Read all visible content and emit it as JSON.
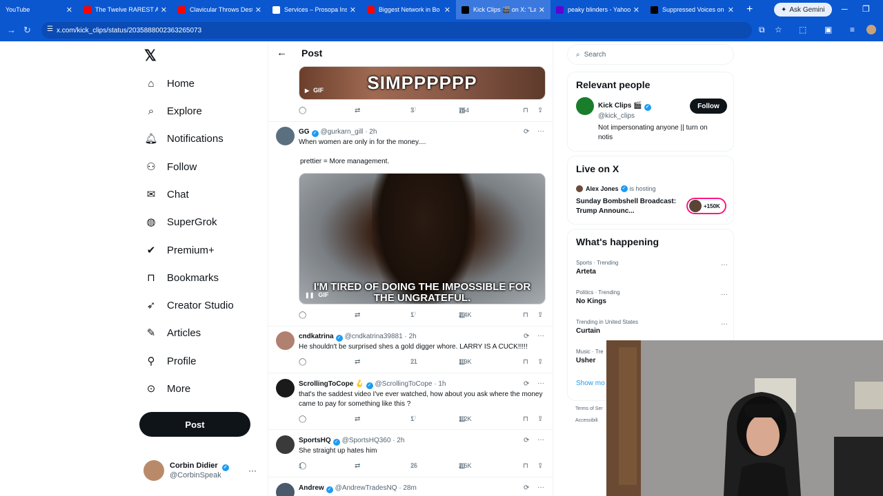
{
  "browser": {
    "tabs": [
      {
        "title": "YouTube",
        "color": "#ffffff"
      },
      {
        "title": "The Twelve RAREST An",
        "color": "#ff0000"
      },
      {
        "title": "Clavicular Throws Dest",
        "color": "#ff0000"
      },
      {
        "title": "Services – Prosopa Insi",
        "color": "#ffffff"
      },
      {
        "title": "Biggest Network in Bo",
        "color": "#ff0000"
      },
      {
        "title": "Kick Clips 🎬 on X: \"La",
        "color": "#000000"
      },
      {
        "title": "peaky blinders - Yahoo",
        "color": "#6001d2"
      },
      {
        "title": "Suppressed Voices on",
        "color": "#000000"
      }
    ],
    "gemini_label": "Ask Gemini",
    "url": "x.com/kick_clips/status/2035888002363265073"
  },
  "nav": {
    "items": [
      {
        "label": "Home",
        "icon": "home-icon"
      },
      {
        "label": "Explore",
        "icon": "search-icon"
      },
      {
        "label": "Notifications",
        "icon": "bell-icon"
      },
      {
        "label": "Follow",
        "icon": "person-plus-icon"
      },
      {
        "label": "Chat",
        "icon": "mail-icon"
      },
      {
        "label": "SuperGrok",
        "icon": "grok-icon"
      },
      {
        "label": "Premium+",
        "icon": "premium-icon"
      },
      {
        "label": "Bookmarks",
        "icon": "bookmark-icon"
      },
      {
        "label": "Creator Studio",
        "icon": "rocket-icon"
      },
      {
        "label": "Articles",
        "icon": "article-icon"
      },
      {
        "label": "Profile",
        "icon": "profile-icon"
      },
      {
        "label": "More",
        "icon": "more-circle-icon"
      }
    ],
    "post_label": "Post",
    "user": {
      "name": "Corbin Didier",
      "handle": "@CorbinSpeak"
    }
  },
  "header": {
    "title": "Post"
  },
  "top_media": {
    "caption": "SIMPPPPPP",
    "badge": "GIF"
  },
  "top_actions": {
    "likes": "3",
    "views": "754"
  },
  "tweets": [
    {
      "name": "GG",
      "handle": "@gurkarn_gill",
      "time": "· 2h",
      "text1": "When women are only in for the money....",
      "text2": "prettier = More management.",
      "media_caption": "I'M TIRED OF DOING THE IMPOSSIBLE FOR THE UNGRATEFUL.",
      "media_badge": "GIF",
      "replies": "",
      "retweets": "",
      "likes": "1",
      "views": "2.4K"
    },
    {
      "name": "cndkatrina",
      "handle": "@cndkatrina39881",
      "time": "· 2h",
      "text1": "He shouldn't be surprised shes a gold digger whore. LARRY IS A CUCK!!!!!",
      "replies": "",
      "retweets": "",
      "likes": "21",
      "views": "1.9K"
    },
    {
      "name": "ScrollingToCope 🪝",
      "handle": "@ScrollingToCope",
      "time": "· 1h",
      "text1": "that's the saddest video I've ever watched, how about you ask where the money came to pay for something like this ?",
      "replies": "",
      "retweets": "",
      "likes": "1",
      "views": "1.2K"
    },
    {
      "name": "SportsHQ",
      "handle": "@SportsHQ360",
      "time": "· 2h",
      "text1": "She straight up hates him",
      "replies": "1",
      "retweets": "",
      "likes": "26",
      "views": "2.6K"
    },
    {
      "name": "Andrew",
      "handle": "@AndrewTradesNQ",
      "time": "· 28m"
    }
  ],
  "right": {
    "search_placeholder": "Search",
    "relevant": {
      "title": "Relevant people",
      "name": "Kick Clips 🎬",
      "handle": "@kick_clips",
      "bio": "Not impersonating anyone || turn on notis",
      "follow_label": "Follow"
    },
    "live": {
      "title": "Live on X",
      "host": "Alex Jones",
      "hosting": "is hosting",
      "show_title": "Sunday Bombshell Broadcast: Trump Announc...",
      "listeners": "+150K"
    },
    "happening": {
      "title": "What's happening",
      "trends": [
        {
          "category": "Sports · Trending",
          "name": "Arteta"
        },
        {
          "category": "Politics · Trending",
          "name": "No Kings"
        },
        {
          "category": "Trending in United States",
          "name": "Curtain"
        },
        {
          "category": "Music · Tre",
          "name": "Usher"
        }
      ],
      "show_more": "Show mo"
    },
    "footer": [
      "Terms of Ser",
      "Accessibili"
    ]
  }
}
